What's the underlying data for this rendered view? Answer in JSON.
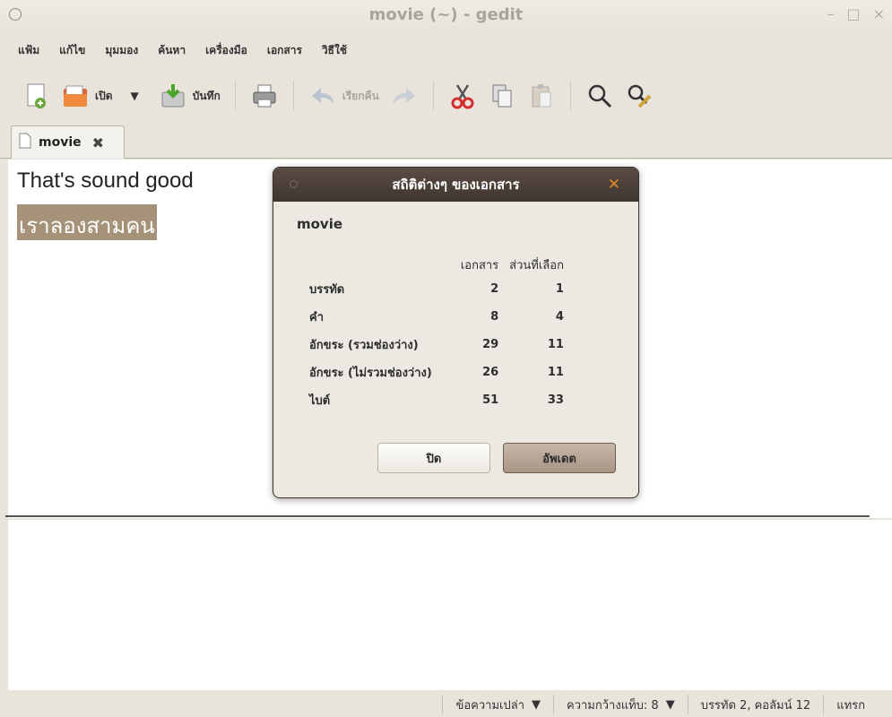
{
  "window": {
    "title": "movie (~) - gedit",
    "buttons": [
      "–",
      "□",
      "×"
    ]
  },
  "menu": [
    "แฟ้ม",
    "แก้ไข",
    "มุมมอง",
    "ค้นหา",
    "เครื่องมือ",
    "เอกสาร",
    "วิธีใช้"
  ],
  "toolbar": {
    "open_label": "เปิด",
    "save_label": "บันทึก",
    "undo_label": "เรียกคืน"
  },
  "tab": {
    "label": "movie"
  },
  "editor": {
    "line1": "That's sound good",
    "line2": "เราลองสามคน"
  },
  "status": {
    "language": "ข้อความเปล่า",
    "tab_width": "ความกว้างแท็บ: 8",
    "position": "บรรทัด 2, คอลัมน์ 12",
    "mode": "แทรก"
  },
  "dialog": {
    "title": "สถิติต่างๆ ของเอกสาร",
    "document": "movie",
    "col_document": "เอกสาร",
    "col_selection": "ส่วนที่เลือก",
    "rows": [
      {
        "label": "บรรทัด",
        "doc": "2",
        "sel": "1"
      },
      {
        "label": "คำ",
        "doc": "8",
        "sel": "4"
      },
      {
        "label": "อักขระ (รวมช่องว่าง)",
        "doc": "29",
        "sel": "11"
      },
      {
        "label": "อักขระ (ไม่รวมช่องว่าง)",
        "doc": "26",
        "sel": "11"
      },
      {
        "label": "ไบต์",
        "doc": "51",
        "sel": "33"
      }
    ],
    "close_button": "ปิด",
    "update_button": "อัพเดต"
  }
}
